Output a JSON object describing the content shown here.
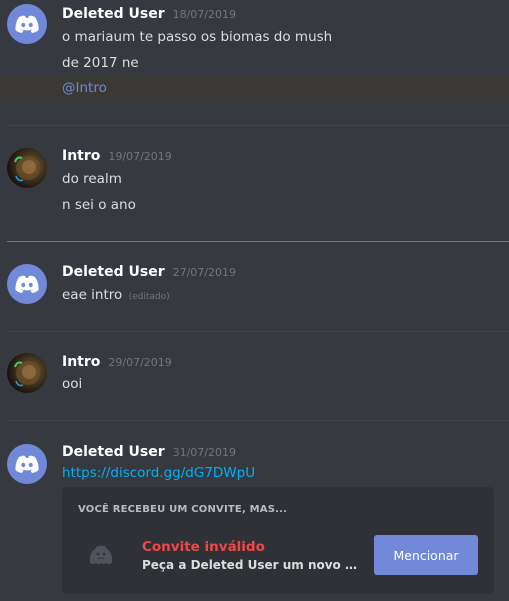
{
  "messages": [
    {
      "username": "Deleted User",
      "timestamp": "18/07/2019",
      "lines": [
        "o mariaum te passo os biomas do mush",
        "de 2017 ne"
      ],
      "mention": "@Intro"
    },
    {
      "username": "Intro",
      "timestamp": "19/07/2019",
      "lines": [
        "do realm",
        "n sei o ano"
      ]
    },
    {
      "username": "Deleted User",
      "timestamp": "27/07/2019",
      "lines": [
        "eae intro"
      ],
      "edited_tag": "(editado)"
    },
    {
      "username": "Intro",
      "timestamp": "29/07/2019",
      "lines": [
        "ooi"
      ]
    },
    {
      "username": "Deleted User",
      "timestamp": "31/07/2019",
      "link": "https://discord.gg/dG7DWpU"
    }
  ],
  "invite": {
    "header": "VOCÊ RECEBEU UM CONVITE, MAS...",
    "title": "Convite inválido",
    "subtitle": "Peça a Deleted User um novo convite!",
    "button_label": "Mencionar"
  },
  "icons": {
    "deleted_avatar": "discord-logo-icon",
    "invite_icon": "sad-blob-icon"
  },
  "colors": {
    "background": "#36393f",
    "brand": "#7289da",
    "link": "#00b0f4",
    "error": "#f04747",
    "card": "#2f3136"
  }
}
